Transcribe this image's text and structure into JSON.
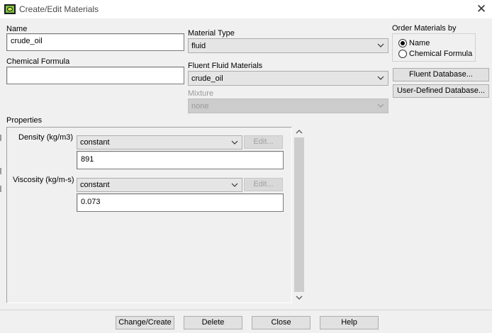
{
  "window": {
    "title": "Create/Edit Materials",
    "close_glyph": "✕",
    "icon": "app-logo-icon"
  },
  "name": {
    "label": "Name",
    "value": "crude_oil"
  },
  "chemical_formula": {
    "label": "Chemical Formula",
    "value": ""
  },
  "material_type": {
    "label": "Material Type",
    "value": "fluid"
  },
  "fluent_fluid_materials": {
    "label": "Fluent Fluid Materials",
    "value": "crude_oil"
  },
  "mixture": {
    "label": "Mixture",
    "value": "none",
    "enabled": false
  },
  "order_by": {
    "label": "Order Materials by",
    "options": [
      {
        "label": "Name",
        "selected": true
      },
      {
        "label": "Chemical Formula",
        "selected": false
      }
    ]
  },
  "side_buttons": {
    "fluent_database": "Fluent Database...",
    "user_defined_database": "User-Defined Database..."
  },
  "properties": {
    "label": "Properties",
    "items": [
      {
        "label": "Density (kg/m3)",
        "method": "constant",
        "edit_label": "Edit...",
        "value": "891"
      },
      {
        "label": "Viscosity (kg/m-s)",
        "method": "constant",
        "edit_label": "Edit...",
        "value": "0.073"
      }
    ]
  },
  "bottom_buttons": {
    "change_create": "Change/Create",
    "delete": "Delete",
    "close": "Close",
    "help": "Help"
  },
  "colors": {
    "background": "#f0f0f0",
    "field_background": "#ffffff",
    "combo_background": "#e5e5e5",
    "disabled_text": "#9a9a9a"
  }
}
